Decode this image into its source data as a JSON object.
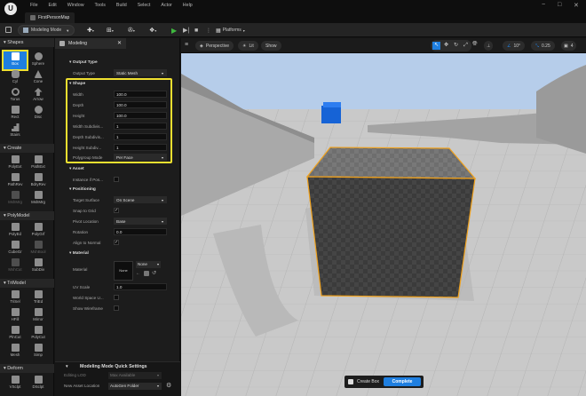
{
  "window": {
    "logo": "U",
    "menu": [
      "File",
      "Edit",
      "Window",
      "Tools",
      "Build",
      "Select",
      "Actor",
      "Help"
    ],
    "tab_title": "FirstPersonMap",
    "controls": [
      "−",
      "□",
      "✕"
    ]
  },
  "toolbar": {
    "mode_label": "Modeling Mode",
    "platforms_label": "Platforms"
  },
  "palette": {
    "categories": [
      {
        "name": "Shapes",
        "tools": [
          "Box",
          "Sphere",
          "Cyl",
          "Cone",
          "Torus",
          "Arrow",
          "Rect",
          "Disc",
          "Stairs"
        ]
      },
      {
        "name": "Create",
        "tools": [
          "PolyExt",
          "PathExt",
          "PathRev",
          "BdryRev",
          "MshMrg",
          "MshMrg"
        ]
      },
      {
        "name": "PolyModel",
        "tools": [
          "PolyEd",
          "PolyGrf",
          "CubeGr",
          "MshBool",
          "MshCut",
          "SubDiv"
        ]
      },
      {
        "name": "TriModel",
        "tools": [
          "TriSel",
          "TriEd",
          "HFill",
          "Mirror",
          "PlnCut",
          "PolyCut",
          "Mesh",
          "Simp"
        ]
      },
      {
        "name": "Deform",
        "tools": [
          "VSclpt",
          "DSclpt"
        ]
      }
    ]
  },
  "details": {
    "tab_label": "Modeling",
    "output_type_section": "Output Type",
    "output_type_label": "Output Type",
    "output_type_value": "Static Mesh",
    "shape_section": "Shape",
    "shape_rows": [
      {
        "label": "Width",
        "value": "100.0"
      },
      {
        "label": "Depth",
        "value": "100.0"
      },
      {
        "label": "Height",
        "value": "100.0"
      },
      {
        "label": "Width Subdivis...",
        "value": "1"
      },
      {
        "label": "Depth Subdivis...",
        "value": "1"
      },
      {
        "label": "Height Subdiv...",
        "value": "1"
      }
    ],
    "polygroup_label": "Polygroup Mode",
    "polygroup_value": "Per Face",
    "asset_section": "Asset",
    "instance_label": "Instance if Pos...",
    "positioning_section": "Positioning",
    "target_surface_label": "Target Surface",
    "target_surface_value": "On Scene",
    "snap_label": "Snap to Grid",
    "pivot_label": "Pivot Location",
    "pivot_value": "Base",
    "rotation_label": "Rotation",
    "rotation_value": "0.0",
    "align_label": "Align to Normal",
    "material_section": "Material",
    "material_label": "Material",
    "material_thumb": "None",
    "material_value": "None",
    "uv_label": "UV Scale",
    "uv_value": "1.0",
    "worldspace_label": "World Space U...",
    "wireframe_label": "Show Wireframe",
    "quick_settings_title": "Modeling Mode Quick Settings",
    "editing_lod_label": "Editing LOD",
    "editing_lod_value": "Max Available",
    "new_asset_label": "New Asset Location",
    "new_asset_value": "AutoGen Folder"
  },
  "viewport": {
    "perspective": "Perspective",
    "lit": "Lit",
    "show": "Show",
    "angle": "10°",
    "scale": "0.25",
    "camera": "4",
    "tool_name": "Create Box",
    "complete_label": "Complete"
  },
  "colors": {
    "accent_blue": "#1f7fe0",
    "highlight_yellow": "#f0e030",
    "box_outline": "#f0a21e",
    "play_green": "#3fb93f"
  }
}
